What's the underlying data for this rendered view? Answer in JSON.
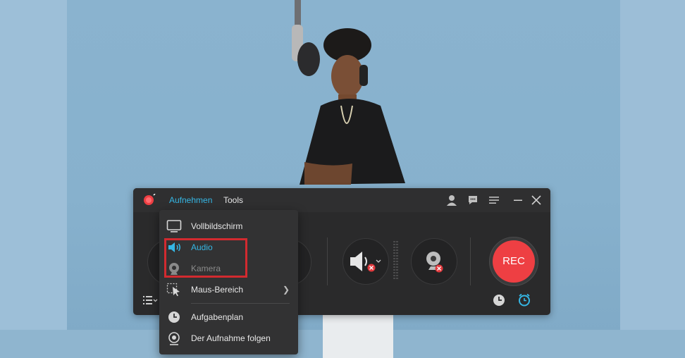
{
  "menu": {
    "record": "Aufnehmen",
    "tools": "Tools"
  },
  "record_button": {
    "label": "REC"
  },
  "dropdown": {
    "items": [
      {
        "label": "Vollbildschirm",
        "icon": "monitor-icon"
      },
      {
        "label": "Audio",
        "icon": "speaker-icon"
      },
      {
        "label": "Kamera",
        "icon": "webcam-icon"
      },
      {
        "label": "Maus-Bereich",
        "icon": "mouse-area-icon"
      },
      {
        "label": "Aufgabenplan",
        "icon": "clock-icon"
      },
      {
        "label": "Der Aufnahme folgen",
        "icon": "follow-target-icon"
      }
    ]
  },
  "colors": {
    "accent": "#35b7e5",
    "rec": "#ee3f43",
    "highlight": "#d22a2f",
    "window_bg": "#2a2a2b"
  }
}
